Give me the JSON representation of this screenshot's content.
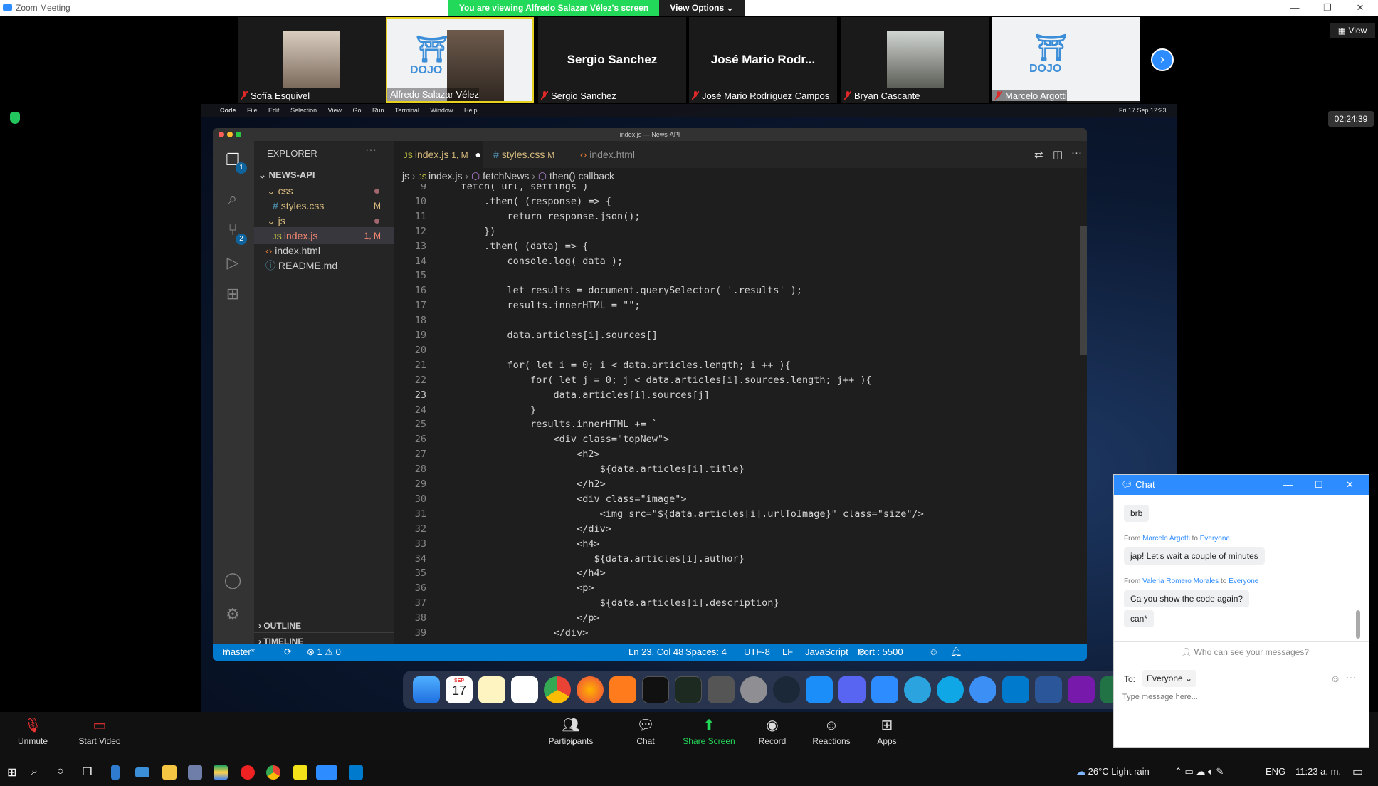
{
  "window": {
    "title": "Zoom Meeting"
  },
  "banner": {
    "viewing": "You are viewing Alfredo Salazar Vélez's screen",
    "view_options": "View Options"
  },
  "participants": [
    {
      "name": "Sofía Esquivel",
      "type": "photo"
    },
    {
      "name": "Alfredo Salazar Vélez",
      "type": "dojo",
      "active": true
    },
    {
      "name": "Sergio Sanchez",
      "type": "text",
      "display": "Sergio Sanchez"
    },
    {
      "name": "José Mario Rodríguez Campos",
      "type": "text",
      "display": "José Mario Rodr..."
    },
    {
      "name": "Bryan Cascante",
      "type": "photo"
    },
    {
      "name": "Marcelo Argotti",
      "type": "dojo"
    }
  ],
  "view_label": "View",
  "timer": "02:24:39",
  "mac_menubar": {
    "app": "Code",
    "items": [
      "File",
      "Edit",
      "Selection",
      "View",
      "Go",
      "Run",
      "Terminal",
      "Window",
      "Help"
    ],
    "clock": "Fri 17 Sep  12:23"
  },
  "vscode": {
    "window_title": "index.js — News-API",
    "activity_badges": {
      "explorer": "1",
      "scm": "2"
    },
    "explorer": {
      "header": "EXPLORER",
      "root": "NEWS-API",
      "items": [
        {
          "label": "css",
          "kind": "folder"
        },
        {
          "label": "styles.css",
          "kind": "css",
          "badge": "M"
        },
        {
          "label": "js",
          "kind": "folder"
        },
        {
          "label": "index.js",
          "kind": "js",
          "badge": "1, M"
        },
        {
          "label": "index.html",
          "kind": "html"
        },
        {
          "label": "README.md",
          "kind": "md"
        }
      ],
      "outline": "OUTLINE",
      "timeline": "TIMELINE"
    },
    "tabs": [
      {
        "label": "index.js",
        "suffix": "1, M",
        "active": true
      },
      {
        "label": "styles.css",
        "suffix": "M"
      },
      {
        "label": "index.html",
        "suffix": ""
      }
    ],
    "breadcrumb": [
      "js",
      "index.js",
      "fetchNews",
      "then() callback"
    ],
    "code": [
      {
        "n": "9",
        "text": "    fetch( url, settings )"
      },
      {
        "n": "10",
        "text": "        .then( (response) => {"
      },
      {
        "n": "11",
        "text": "            return response.json();"
      },
      {
        "n": "12",
        "text": "        })"
      },
      {
        "n": "13",
        "text": "        .then( (data) => {"
      },
      {
        "n": "14",
        "text": "            console.log( data );"
      },
      {
        "n": "15",
        "text": ""
      },
      {
        "n": "16",
        "text": "            let results = document.querySelector( '.results' );"
      },
      {
        "n": "17",
        "text": "            results.innerHTML = \"\";"
      },
      {
        "n": "18",
        "text": ""
      },
      {
        "n": "19",
        "text": "            data.articles[i].sources[]"
      },
      {
        "n": "20",
        "text": ""
      },
      {
        "n": "21",
        "text": "            for( let i = 0; i < data.articles.length; i ++ ){"
      },
      {
        "n": "22",
        "text": "                for( let j = 0; j < data.articles[i].sources.length; j++ ){"
      },
      {
        "n": "23",
        "text": "                    data.articles[i].sources[j]"
      },
      {
        "n": "24",
        "text": "                }"
      },
      {
        "n": "25",
        "text": "                results.innerHTML += `"
      },
      {
        "n": "26",
        "text": "                    <div class=\"topNew\">"
      },
      {
        "n": "27",
        "text": "                        <h2>"
      },
      {
        "n": "28",
        "text": "                            ${data.articles[i].title}"
      },
      {
        "n": "29",
        "text": "                        </h2>"
      },
      {
        "n": "30",
        "text": "                        <div class=\"image\">"
      },
      {
        "n": "31",
        "text": "                            <img src=\"${data.articles[i].urlToImage}\" class=\"size\"/>"
      },
      {
        "n": "32",
        "text": "                        </div>"
      },
      {
        "n": "33",
        "text": "                        <h4>"
      },
      {
        "n": "34",
        "text": "                           ${data.articles[i].author}"
      },
      {
        "n": "35",
        "text": "                        </h4>"
      },
      {
        "n": "36",
        "text": "                        <p>"
      },
      {
        "n": "37",
        "text": "                            ${data.articles[i].description}"
      },
      {
        "n": "38",
        "text": "                        </p>"
      },
      {
        "n": "39",
        "text": "                    </div>"
      }
    ],
    "status": {
      "branch": "master*",
      "problems": "⊗ 1 ⚠ 0",
      "position": "Ln 23, Col 48",
      "spaces": "Spaces: 4",
      "encoding": "UTF-8",
      "eol": "LF",
      "language": "JavaScript",
      "port": "Port : 5500"
    }
  },
  "dock_calendar": {
    "month": "SEP",
    "day": "17"
  },
  "controls": {
    "unmute": "Unmute",
    "start_video": "Start Video",
    "participants": "Participants",
    "participants_count": "24",
    "chat": "Chat",
    "share": "Share Screen",
    "record": "Record",
    "reactions": "Reactions",
    "apps": "Apps"
  },
  "chat": {
    "title": "Chat",
    "messages": [
      {
        "from": "",
        "to": "",
        "text": "brb"
      },
      {
        "from": "Marcelo Argotti",
        "to": "Everyone",
        "text": "jap! Let's wait a couple of minutes"
      },
      {
        "from": "Valeria Romero Morales",
        "to": "Everyone",
        "text": "Ca you show the code again?"
      },
      {
        "from": "",
        "to": "",
        "text": "can*"
      }
    ],
    "from_label": "From",
    "to_label": "to",
    "who_can_see": "Who can see your messages?",
    "to_prefix": "To:",
    "recipient": "Everyone",
    "placeholder": "Type message here..."
  },
  "taskbar": {
    "weather": "26°C  Light rain",
    "lang": "ENG",
    "time": "11:23 a. m."
  }
}
